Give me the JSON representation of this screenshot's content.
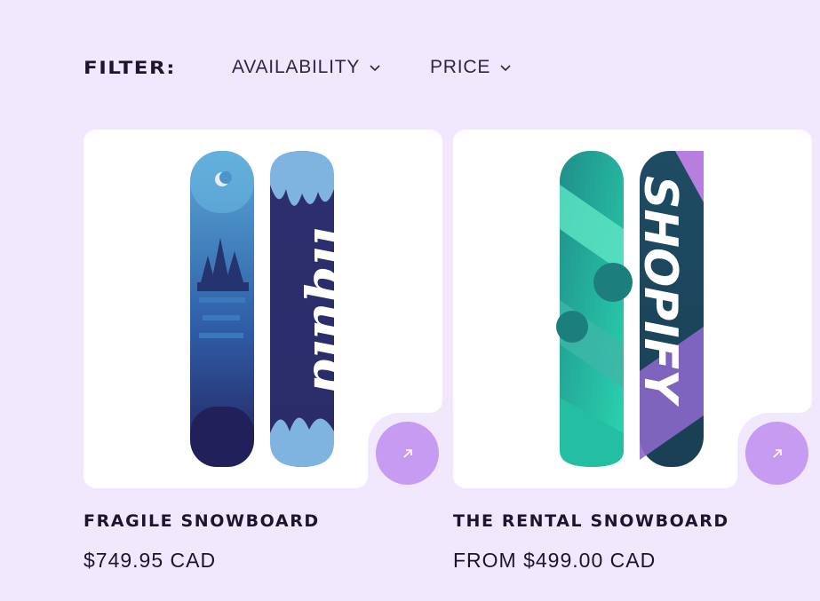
{
  "filters": {
    "label": "FILTER:",
    "items": [
      {
        "label": "AVAILABILITY",
        "icon": "chevron-down-icon"
      },
      {
        "label": "PRICE",
        "icon": "chevron-down-icon"
      }
    ]
  },
  "products": [
    {
      "title": "FRAGILE SNOWBOARD",
      "price": "$749.95 CAD",
      "board_text": "liquid",
      "action_icon": "arrow-up-right-icon"
    },
    {
      "title": "THE RENTAL SNOWBOARD",
      "price": "FROM $499.00 CAD",
      "board_text": "SHOPIFY",
      "action_icon": "arrow-up-right-icon"
    }
  ],
  "colors": {
    "page_background": "#f1e8fd",
    "card_background": "#ffffff",
    "action_button": "#c79bf2",
    "text": "#1b1530"
  }
}
